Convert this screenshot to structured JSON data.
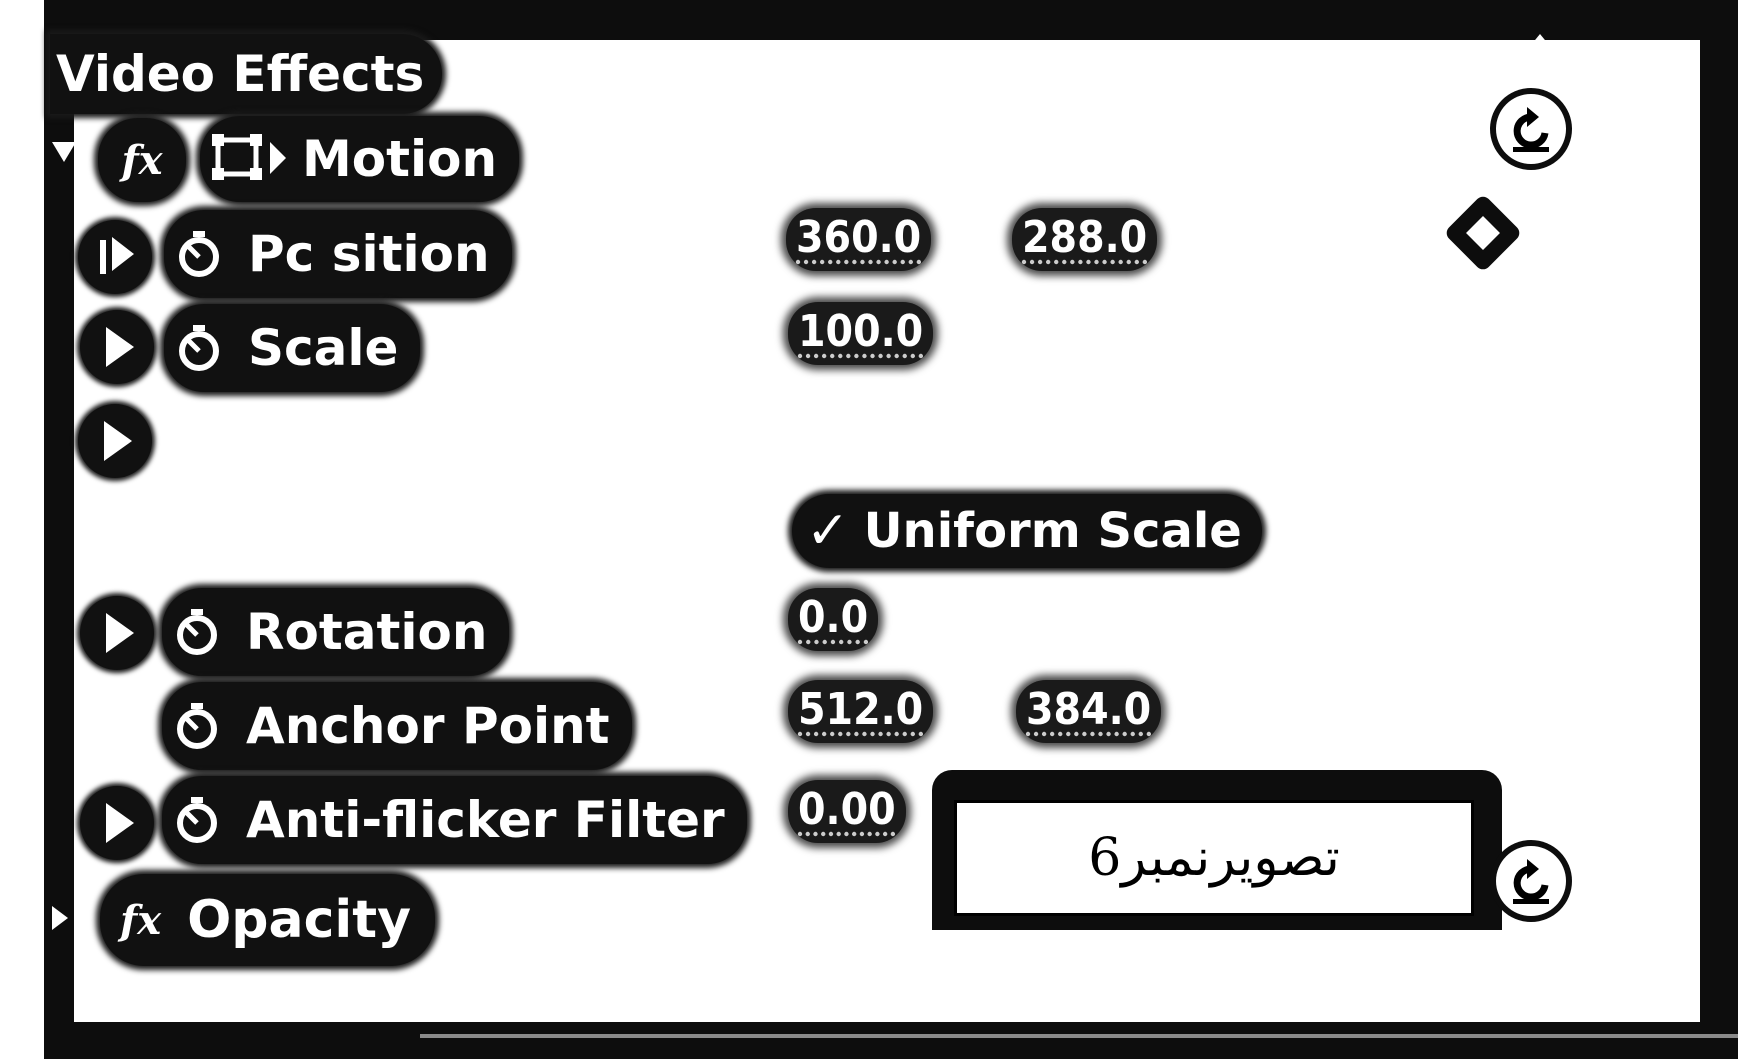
{
  "panel": {
    "title": "Video Effects"
  },
  "motion": {
    "fx_label": "fx",
    "label": "Motion"
  },
  "properties": {
    "position": {
      "label": "Pc sition",
      "x": "360.0",
      "y": "288.0"
    },
    "scale": {
      "label": "Scale",
      "value": "100.0"
    },
    "uniform_scale": {
      "label": "Uniform Scale",
      "checked": true
    },
    "rotation": {
      "label": "Rotation",
      "value": "0.0"
    },
    "anchor_point": {
      "label": "Anchor Point",
      "x": "512.0",
      "y": "384.0"
    },
    "anti_flicker": {
      "label": "Anti-flicker Filter",
      "value": "0.00"
    }
  },
  "opacity": {
    "fx_label": "fx",
    "label": "Opacity"
  },
  "caption": {
    "text": "تصویرنمبر6"
  },
  "icons": {
    "reset": "reset-icon",
    "keyframe": "keyframe-diamond-icon",
    "stopwatch": "stopwatch-icon",
    "expand": "expand-triangle-icon",
    "motion_box": "motion-transform-icon",
    "checkmark": "checkmark-icon",
    "scroll_up": "scroll-up-icon"
  }
}
